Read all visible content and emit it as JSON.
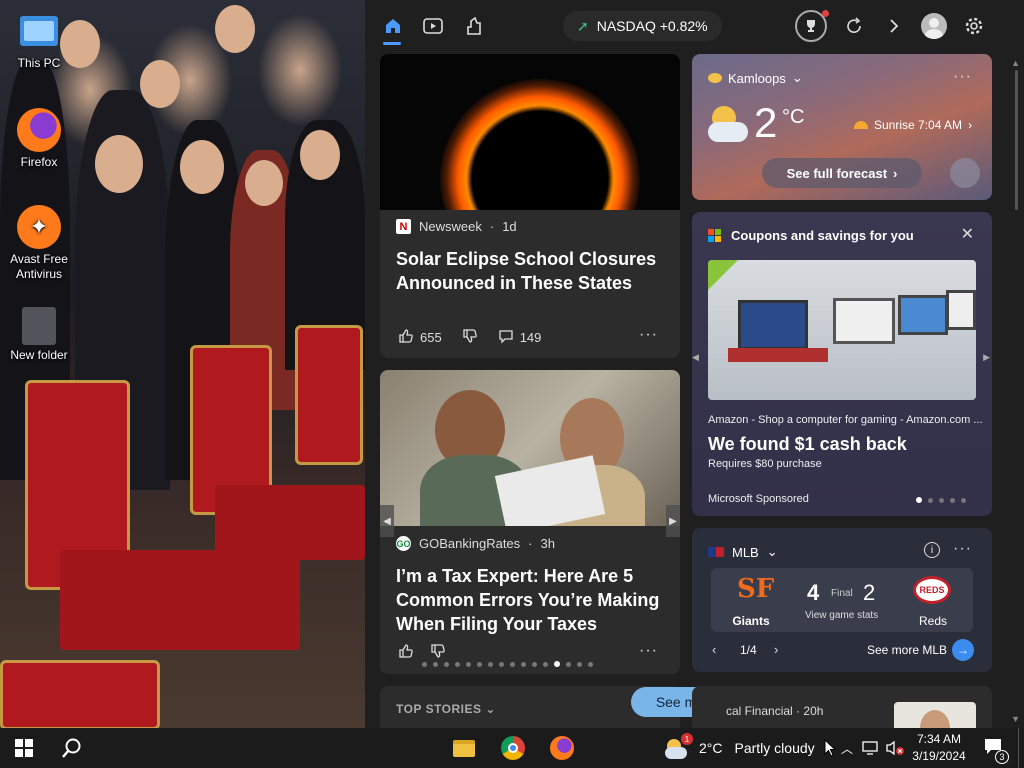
{
  "desktop": {
    "icons": [
      {
        "label": "This PC",
        "icon": "computer-icon"
      },
      {
        "label": "Firefox",
        "icon": "firefox-icon"
      },
      {
        "label": "Avast Free Antivirus",
        "icon": "avast-icon"
      },
      {
        "label": "New folder",
        "icon": "folder-icon"
      }
    ]
  },
  "topbar": {
    "ticker_label": "NASDAQ +0.82%",
    "ticker_trend": "up"
  },
  "news1": {
    "source": "Newsweek",
    "age": "1d",
    "headline": "Solar Eclipse School Closures Announced in These States",
    "likes": "655",
    "comments": "149"
  },
  "news2": {
    "source": "GOBankingRates",
    "age": "3h",
    "headline": "I’m a Tax Expert: Here Are 5 Common Errors You’re Making When Filing Your Taxes",
    "dot_count": 16,
    "active_dot": 12
  },
  "weather": {
    "location": "Kamloops",
    "temp": "2",
    "unit": "°C",
    "sunrise": "Sunrise 7:04 AM",
    "forecast_button": "See full forecast"
  },
  "coupons": {
    "title": "Coupons and savings for you",
    "merchant": "Amazon - Shop a computer for gaming - Amazon.com ...",
    "offer": "We found $1 cash back",
    "requirement": "Requires $80 purchase",
    "sponsor": "Microsoft Sponsored",
    "dot_count": 5,
    "active_dot": 0
  },
  "mlb": {
    "title": "MLB",
    "team_home": "Giants",
    "team_away": "Reds",
    "score_home": "4",
    "score_away": "2",
    "status": "Final",
    "stats_link": "View game stats",
    "pager": "1/4",
    "see_more": "See more MLB"
  },
  "bottom": {
    "section": "TOP STORIES",
    "see_more": "See more",
    "source_partial": "cal Financial",
    "age": "20h"
  },
  "taskbar": {
    "weather_temp": "2°C",
    "weather_desc": "Partly cloudy",
    "weather_badge": "1",
    "time": "7:34 AM",
    "date": "3/19/2024",
    "notif_count": "3"
  },
  "colors": {
    "panel_bg": "#1f1f1f",
    "card_bg": "#2c2c2c",
    "accent": "#3c8cf0",
    "ticker_up": "#3cc37a"
  }
}
